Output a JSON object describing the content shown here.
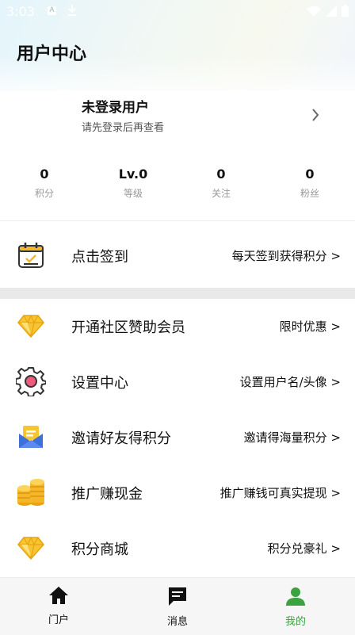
{
  "status_bar": {
    "time": "3:03",
    "notification_a": "A"
  },
  "header": {
    "title": "用户中心"
  },
  "user": {
    "name": "未登录用户",
    "subtitle": "请先登录后再查看"
  },
  "stats": [
    {
      "value": "0",
      "label": "积分"
    },
    {
      "value": "Lv.0",
      "label": "等级"
    },
    {
      "value": "0",
      "label": "关注"
    },
    {
      "value": "0",
      "label": "粉丝"
    }
  ],
  "checkin": {
    "title": "点击签到",
    "hint": "每天签到获得积分 >",
    "icon": "calendar-check-icon"
  },
  "menu": [
    {
      "title": "开通社区赞助会员",
      "hint": "限时优惠 >",
      "icon": "diamond-icon"
    },
    {
      "title": "设置中心",
      "hint": "设置用户名/头像 >",
      "icon": "gear-icon"
    },
    {
      "title": "邀请好友得积分",
      "hint": "邀请得海量积分 >",
      "icon": "invite-mail-icon"
    },
    {
      "title": "推广赚现金",
      "hint": "推广赚钱可真实提现 >",
      "icon": "coins-icon"
    },
    {
      "title": "积分商城",
      "hint": "积分兑豪礼 >",
      "icon": "diamond-icon"
    }
  ],
  "bottom_nav": [
    {
      "label": "门户",
      "icon": "home-icon",
      "active": false
    },
    {
      "label": "消息",
      "icon": "message-icon",
      "active": false
    },
    {
      "label": "我的",
      "icon": "person-icon",
      "active": true
    }
  ],
  "colors": {
    "accent": "#3aa33f",
    "icon_yellow": "#f5b72a",
    "gear_pink": "#ef5b7d"
  }
}
